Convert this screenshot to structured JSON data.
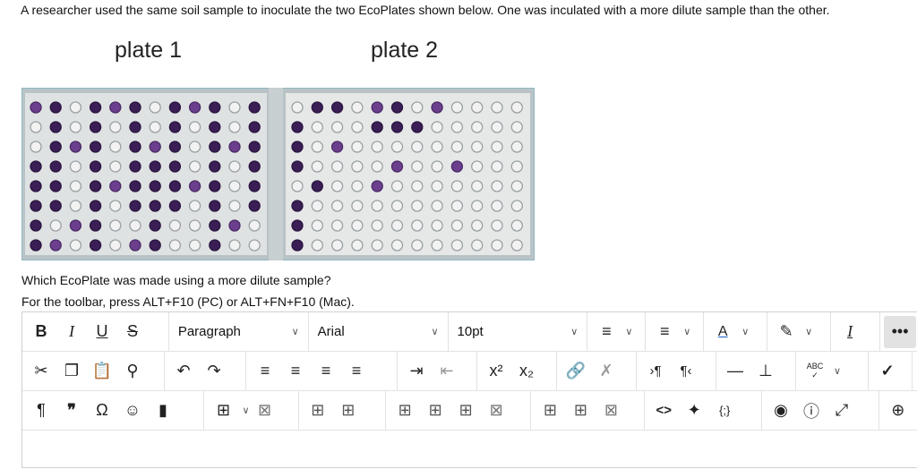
{
  "question": {
    "intro": "A researcher used the same soil sample to inoculate the two EcoPlates shown below. One was inculated with a more dilute sample than the other.",
    "plate1_label": "plate 1",
    "plate2_label": "plate 2",
    "prompt": "Which EcoPlate was made using a more dilute sample?",
    "toolbar_hint": "For the toolbar, press ALT+F10 (PC) or ALT+FN+F10 (Mac)."
  },
  "toolbar": {
    "bold": "B",
    "italic": "I",
    "underline": "U",
    "strike": "S",
    "block_format": "Paragraph",
    "font_family": "Arial",
    "font_size": "10pt",
    "superscript": "x²",
    "subscript": "x₂",
    "paragraph_mark": "¶",
    "quote": "❞",
    "omega": "Ω",
    "code": "<>",
    "spellcheck_label": "ABC",
    "icons": [
      "bold",
      "italic",
      "underline",
      "strikethrough",
      "bulleted-list",
      "numbered-list",
      "text-color",
      "highlight",
      "clear-formatting",
      "more",
      "cut",
      "copy",
      "paste",
      "find",
      "undo",
      "redo",
      "align-left",
      "align-center",
      "align-right",
      "justify",
      "indent",
      "outdent",
      "superscript",
      "subscript",
      "link",
      "unlink",
      "ltr",
      "rtl",
      "horizontal-rule",
      "anchor",
      "spellcheck",
      "math",
      "paragraph",
      "quote",
      "special-char",
      "emoji",
      "bookmark",
      "table",
      "table-delete",
      "table-col-before",
      "table-col-after",
      "table-row-before",
      "table-row-after",
      "table-delete-row",
      "table-merge",
      "table-split",
      "table-delete-col",
      "code",
      "accessibility",
      "code-sample",
      "preview",
      "help",
      "fullscreen",
      "add"
    ]
  },
  "colors": {
    "well_dark": "#3a1e55",
    "well_purple": "#6c3f8e",
    "plate_frame": "#8fb8c4"
  }
}
